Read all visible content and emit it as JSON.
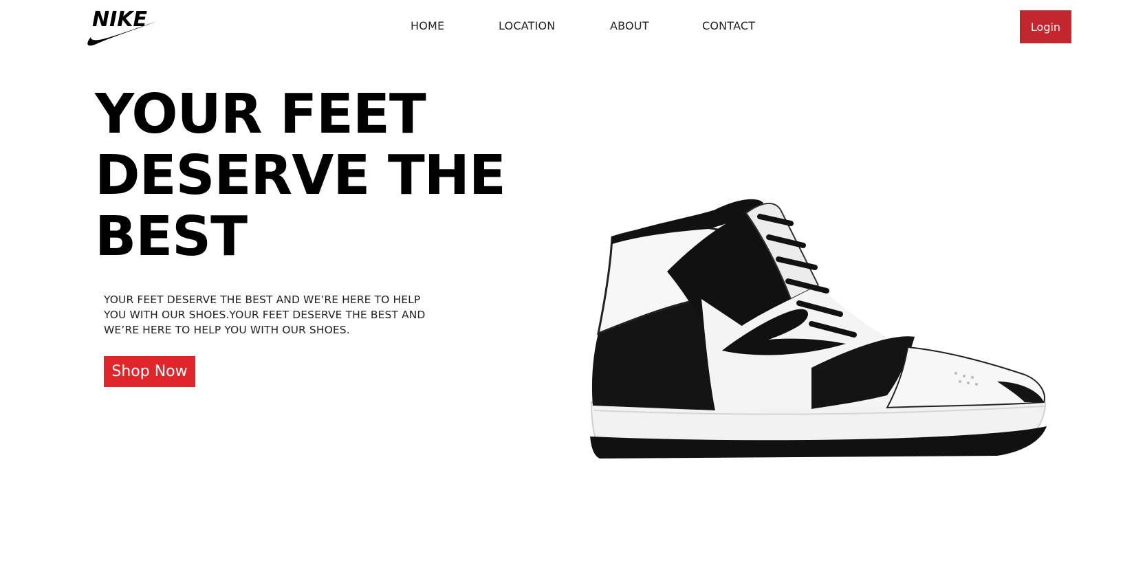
{
  "brand": {
    "logo_text": "NIKE",
    "logo_icon": "nike-swoosh-icon"
  },
  "nav": {
    "items": [
      {
        "label": "HOME"
      },
      {
        "label": "LOCATION"
      },
      {
        "label": "ABOUT"
      },
      {
        "label": "CONTACT"
      }
    ]
  },
  "header": {
    "login_label": "Login"
  },
  "hero": {
    "title_lines": [
      "YOUR FEET",
      "DESERVE THE",
      "BEST"
    ],
    "description": "YOUR FEET DESERVE THE BEST AND WE’RE HERE TO HELP YOU WITH OUR SHOES.YOUR FEET DESERVE THE BEST AND WE’RE HERE TO HELP YOU WITH OUR SHOES.",
    "cta_label": "Shop Now",
    "image_icon": "sneaker-image"
  },
  "colors": {
    "accent": "#e0262b",
    "login_bg": "#c1272d",
    "text": "#000000",
    "background": "#ffffff"
  }
}
